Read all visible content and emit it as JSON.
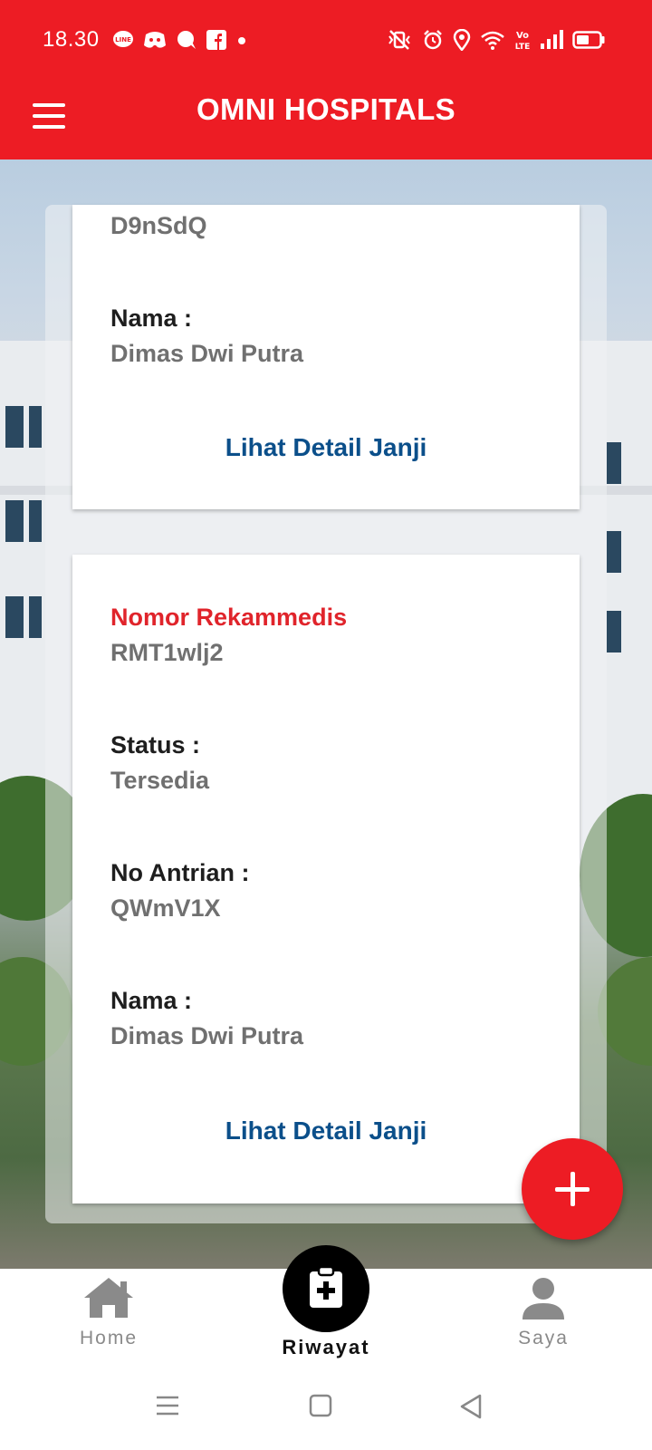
{
  "status_bar": {
    "time": "18.30",
    "notification_icons": [
      "line-icon",
      "discord-icon",
      "chat-bubble-icon",
      "facebook-icon",
      "dot-icon"
    ],
    "system_icons": [
      "vibrate-off-icon",
      "alarm-icon",
      "location-icon",
      "wifi-icon",
      "volte-icon",
      "signal-icon",
      "battery-icon"
    ]
  },
  "header": {
    "title": "OMNI HOSPITALS",
    "menu_icon": "hamburger-menu-icon",
    "background_color": "#ED1C24"
  },
  "appointments": [
    {
      "code_value": "D9nSdQ",
      "nama_label": "Nama :",
      "nama_value": "Dimas Dwi Putra",
      "detail_link": "Lihat Detail Janji"
    },
    {
      "rekam_label": "Nomor Rekammedis",
      "rekam_value": "RMT1wlj2",
      "status_label": "Status :",
      "status_value": "Tersedia",
      "antrian_label": "No Antrian :",
      "antrian_value": "QWmV1X",
      "nama_label": "Nama :",
      "nama_value": "Dimas Dwi Putra",
      "detail_link": "Lihat Detail Janji"
    }
  ],
  "fab": {
    "icon": "plus-icon"
  },
  "bottom_nav": {
    "items": [
      {
        "label": "Home",
        "icon": "home-icon",
        "active": false
      },
      {
        "label": "Riwayat",
        "icon": "clipboard-medical-icon",
        "active": true
      },
      {
        "label": "Saya",
        "icon": "person-icon",
        "active": false
      }
    ]
  },
  "system_nav": [
    "recents-icon",
    "home-square-icon",
    "back-triangle-icon"
  ],
  "colors": {
    "brand_red": "#ED1C24",
    "link_blue": "#0B4F8A",
    "label_red": "#E0242B"
  }
}
